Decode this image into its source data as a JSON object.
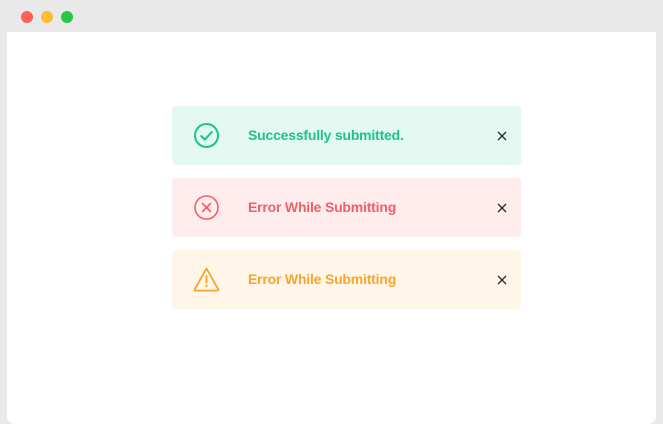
{
  "window": {
    "controls": {
      "close_color": "#fe5f57",
      "minimize_color": "#febc2e",
      "maximize_color": "#28c840"
    }
  },
  "alerts": [
    {
      "type": "success",
      "message": "Successfully submitted.",
      "icon": "check-circle-icon",
      "text_color": "#1fc28a",
      "background": "#e2f8f0"
    },
    {
      "type": "error",
      "message": "Error While Submitting",
      "icon": "x-circle-icon",
      "text_color": "#f0606a",
      "background": "#ffeded"
    },
    {
      "type": "warning",
      "message": "Error While Submitting",
      "icon": "warning-triangle-icon",
      "text_color": "#f6a72b",
      "background": "#fff5e8"
    }
  ],
  "close_icon": "close-icon"
}
